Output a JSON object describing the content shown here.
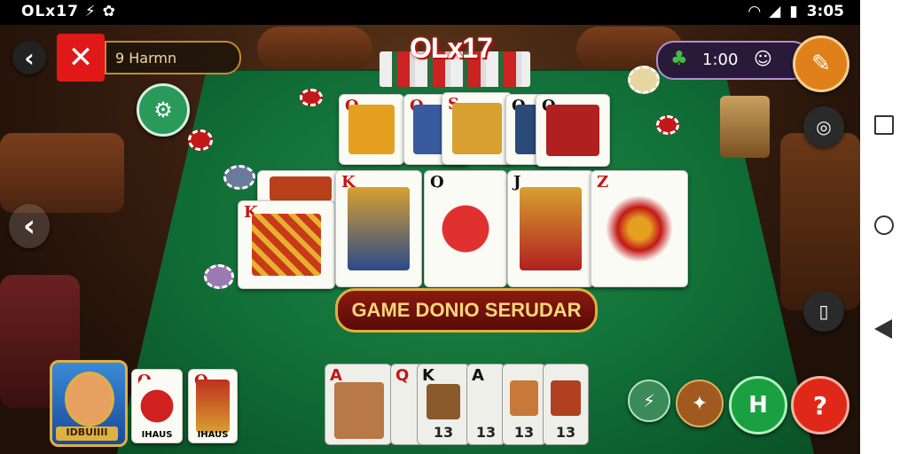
{
  "status_bar": {
    "left_text": "OLx17 ⚡ ✿",
    "time": "3:05"
  },
  "top_left": {
    "back_label": "‹",
    "close_label": "✕",
    "player_tag": "9 Harmn"
  },
  "logo": "OLx17",
  "timer": {
    "value": "1:00"
  },
  "banner": "GAME DONIO SERUDAR",
  "player_name": "IDBUIIII",
  "hand_small_cards": [
    {
      "rank": "Q",
      "label": "IHAUS"
    },
    {
      "rank": "Q",
      "label": "IHAUS"
    }
  ],
  "hand_cards": [
    {
      "rank": "A",
      "label": ""
    },
    {
      "rank": "Q",
      "label": ""
    },
    {
      "rank": "K",
      "label": "13"
    },
    {
      "rank": "A",
      "label": "13"
    },
    {
      "rank": "",
      "label": "13"
    },
    {
      "rank": "",
      "label": "13"
    }
  ],
  "table_top_cards": [
    {
      "rank": "Q"
    },
    {
      "rank": "Q"
    },
    {
      "rank": "S"
    },
    {
      "rank": "Q"
    },
    {
      "rank": "Q"
    }
  ],
  "table_main_cards": [
    {
      "rank": "K"
    },
    {
      "rank": "K"
    },
    {
      "rank": "Q"
    },
    {
      "rank": "J"
    },
    {
      "rank": "Z"
    }
  ],
  "colors": {
    "felt": "#137a3e",
    "accent_red": "#d01818",
    "gold": "#e0b040"
  },
  "icons": [
    "back-icon",
    "close-icon",
    "settings-icon",
    "clover-icon",
    "chat-icon",
    "edit-icon",
    "map-icon",
    "scroll-icon",
    "lightning-icon",
    "bird-icon",
    "h-icon",
    "question-icon"
  ]
}
